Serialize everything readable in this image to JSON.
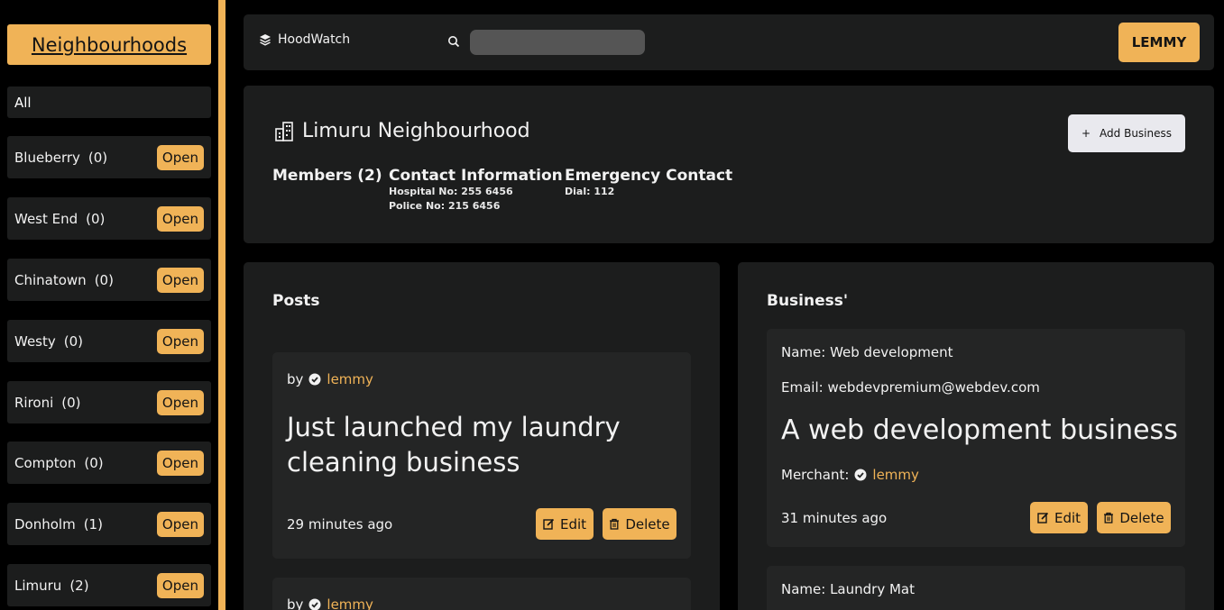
{
  "sidebar": {
    "title": "Neighbourhoods",
    "all_label": "All",
    "open_label": "Open",
    "items": [
      {
        "name": "Blueberry",
        "count": "(0)"
      },
      {
        "name": "West End",
        "count": "(0)"
      },
      {
        "name": "Chinatown",
        "count": "(0)"
      },
      {
        "name": "Westy",
        "count": "(0)"
      },
      {
        "name": "Rironi",
        "count": "(0)"
      },
      {
        "name": "Compton",
        "count": "(0)"
      },
      {
        "name": "Donholm",
        "count": "(1)"
      },
      {
        "name": "Limuru",
        "count": "(2)"
      }
    ]
  },
  "topbar": {
    "brand": "HoodWatch",
    "search_placeholder": "",
    "user_button": "LEMMY",
    "brand_icon": "layers-icon",
    "search_icon": "search-icon"
  },
  "neighbourhood": {
    "title": "Limuru Neighbourhood",
    "add_business": "Add Business",
    "members": "Members (2)",
    "contact_title": "Contact Information",
    "hospital": "Hospital No: 255 6456",
    "police": "Police No: 215 6456",
    "emergency_title": "Emergency Contact",
    "dial": "Dial: 112"
  },
  "posts": {
    "title": "Posts",
    "items": [
      {
        "by": "by",
        "author": "lemmy",
        "text": "Just launched my laundry cleaning business",
        "time": "29 minutes ago",
        "edit": "Edit",
        "delete": "Delete"
      },
      {
        "by": "by",
        "author": "lemmy"
      }
    ]
  },
  "businesses": {
    "title": "Business'",
    "items": [
      {
        "name": "Name: Web development",
        "email": "Email: webdevpremium@webdev.com",
        "description": "A web development business",
        "merchant_label": "Merchant:",
        "merchant": "lemmy",
        "time": "31 minutes ago",
        "edit": "Edit",
        "delete": "Delete"
      },
      {
        "name": "Name: Laundry Mat"
      }
    ]
  },
  "colors": {
    "accent": "#f0b357",
    "panel": "#1c1d1d",
    "card": "#242525",
    "background": "#000000"
  }
}
